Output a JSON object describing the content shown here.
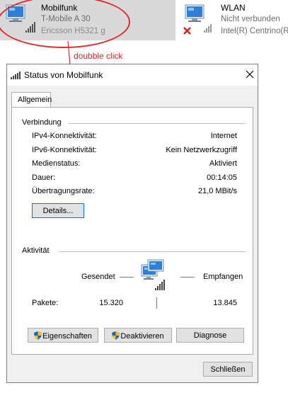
{
  "adapters": [
    {
      "name": "Mobilfunk",
      "line1": "T-Mobile A  30",
      "line2": "Ericsson H5321 g"
    },
    {
      "name": "WLAN",
      "line1": "Nicht verbunden",
      "line2": "Intel(R) Centrino(R"
    }
  ],
  "annotation": "doubble click",
  "dialog": {
    "title": "Status von Mobilfunk",
    "tab": "Allgemein",
    "connection": {
      "heading": "Verbindung",
      "rows": [
        {
          "label": "IPv4-Konnektivität:",
          "value": "Internet"
        },
        {
          "label": "IPv6-Konnektivität:",
          "value": "Kein Netzwerkzugriff"
        },
        {
          "label": "Medienstatus:",
          "value": "Aktiviert"
        },
        {
          "label": "Dauer:",
          "value": "00:14:05"
        },
        {
          "label": "Übertragungsrate:",
          "value": "21,0 MBit/s"
        }
      ],
      "details_button": "Details..."
    },
    "activity": {
      "heading": "Aktivität",
      "sent_label": "Gesendet",
      "received_label": "Empfangen",
      "packets_label": "Pakete:",
      "packets_sent": "15.320",
      "packets_received": "13.845"
    },
    "buttons": {
      "properties": "Eigenschaften",
      "disable": "Deaktivieren",
      "diagnose": "Diagnose",
      "close": "Schließen"
    }
  },
  "colors": {
    "annotation": "#d42222",
    "selection": "#d9d9d9",
    "dialog_bg": "#f0f0f0",
    "focus_border": "#0078d7"
  },
  "icons": [
    "network-adapter-icon",
    "signal-bars-icon",
    "disconnected-x-icon",
    "uac-shield-icon",
    "close-icon",
    "network-activity-icon"
  ]
}
